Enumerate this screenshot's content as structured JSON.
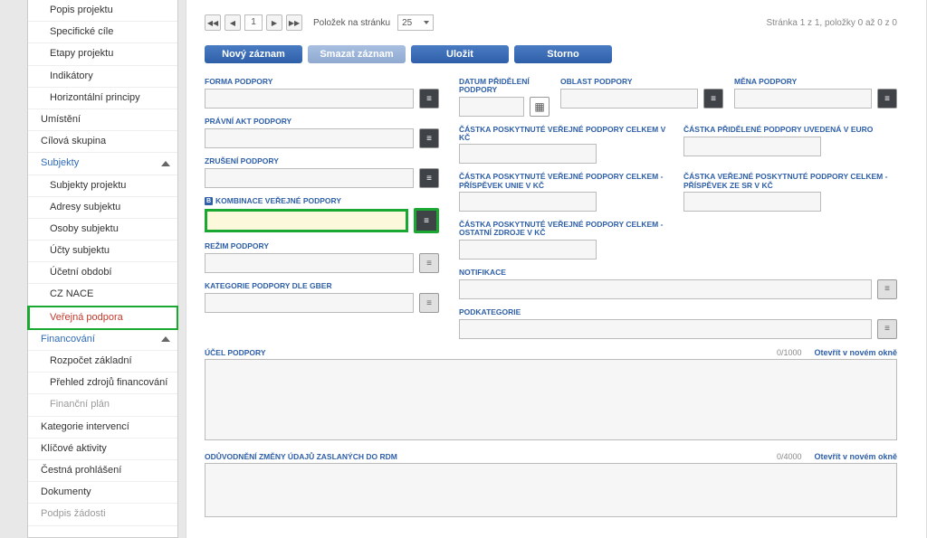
{
  "sidebar": {
    "items": [
      {
        "label": "Popis projektu",
        "sub": true
      },
      {
        "label": "Specifické cíle",
        "sub": true
      },
      {
        "label": "Etapy projektu",
        "sub": true
      },
      {
        "label": "Indikátory",
        "sub": true
      },
      {
        "label": "Horizontální principy",
        "sub": true
      },
      {
        "label": "Umístění"
      },
      {
        "label": "Cílová skupina"
      },
      {
        "label": "Subjekty",
        "section": true,
        "chevron": true
      },
      {
        "label": "Subjekty projektu",
        "sub": true
      },
      {
        "label": "Adresy subjektu",
        "sub": true
      },
      {
        "label": "Osoby subjektu",
        "sub": true
      },
      {
        "label": "Účty subjektu",
        "sub": true
      },
      {
        "label": "Účetní období",
        "sub": true
      },
      {
        "label": "CZ NACE",
        "sub": true
      },
      {
        "label": "Veřejná podpora",
        "sub": true,
        "active": true
      },
      {
        "label": "Financování",
        "section": true,
        "chevron": true
      },
      {
        "label": "Rozpočet základní",
        "sub": true
      },
      {
        "label": "Přehled zdrojů financování",
        "sub": true
      },
      {
        "label": "Finanční plán",
        "sub": true,
        "disabled": true
      },
      {
        "label": "Kategorie intervencí"
      },
      {
        "label": "Klíčové aktivity"
      },
      {
        "label": "Čestná prohlášení"
      },
      {
        "label": "Dokumenty"
      },
      {
        "label": "Podpis žádosti",
        "disabled": true
      }
    ]
  },
  "pager": {
    "page": "1",
    "per_page_label": "Položek na stránku",
    "per_page_value": "25",
    "right_text": "Stránka 1 z 1, položky 0 až 0 z 0"
  },
  "buttons": {
    "new": "Nový záznam",
    "delete": "Smazat záznam",
    "save": "Uložit",
    "cancel": "Storno"
  },
  "form": {
    "left": {
      "forma_podpody": {
        "label": "FORMA PODPORY"
      },
      "pravni_akt": {
        "label": "PRÁVNÍ AKT PODPORY"
      },
      "zruseni": {
        "label": "ZRUŠENÍ PODPORY"
      },
      "kombinace": {
        "label": "KOMBINACE VEŘEJNÉ PODPORY"
      },
      "rezim": {
        "label": "REŽIM PODPORY"
      },
      "kategorie_gber": {
        "label": "KATEGORIE PODPORY DLE GBER"
      }
    },
    "right": {
      "datum": {
        "label": "DATUM PŘIDĚLENÍ PODPORY"
      },
      "oblast": {
        "label": "OBLAST PODPORY"
      },
      "mena": {
        "label": "MĚNA PODPORY"
      },
      "castka_celkem_kc": {
        "label": "ČÁSTKA POSKYTNUTÉ VEŘEJNÉ PODPORY CELKEM V KČ"
      },
      "castka_pridelene_euro": {
        "label": "ČÁSTKA PŘIDĚLENÉ PODPORY UVEDENÁ V EURO"
      },
      "castka_prispevek_unie": {
        "label": "ČÁSTKA POSKYTNUTÉ VEŘEJNÉ PODPORY CELKEM - PŘÍSPĚVEK UNIE V KČ"
      },
      "castka_prispevek_sr": {
        "label": "ČÁSTKA VEŘEJNÉ POSKYTNUTÉ PODPORY CELKEM - PŘÍSPĚVEK ZE SR V KČ"
      },
      "castka_ostatni": {
        "label": "ČÁSTKA POSKYTNUTÉ VEŘEJNÉ PODPORY CELKEM - OSTATNÍ ZDROJE V KČ"
      },
      "notifikace": {
        "label": "NOTIFIKACE"
      },
      "podkategorie": {
        "label": "PODKATEGORIE"
      }
    },
    "ucel": {
      "label": "ÚČEL PODPORY",
      "count": "0/1000",
      "link": "Otevřít v novém okně"
    },
    "oduvodneni": {
      "label": "ODŮVODNĚNÍ ZMĚNY ÚDAJŮ ZASLANÝCH DO RDM",
      "count": "0/4000",
      "link": "Otevřít v novém okně"
    }
  }
}
